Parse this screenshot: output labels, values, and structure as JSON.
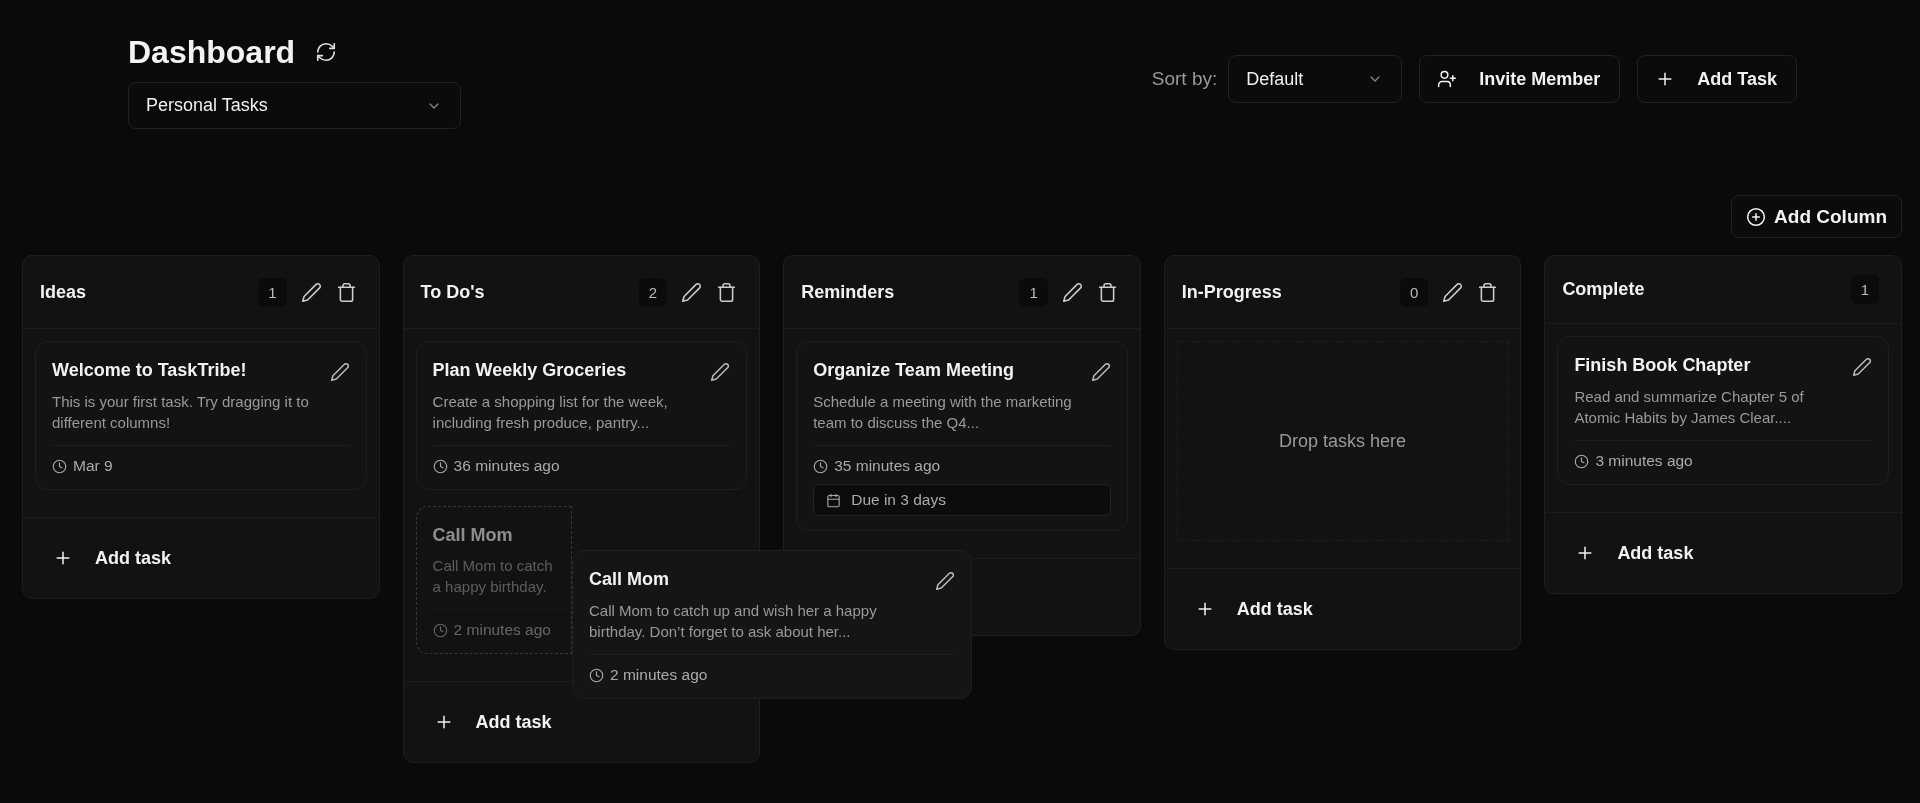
{
  "header": {
    "title": "Dashboard",
    "board_select": {
      "value": "Personal Tasks"
    },
    "sort_label": "Sort by:",
    "sort_select": {
      "value": "Default"
    },
    "buttons": [
      {
        "kind": "invite",
        "label": "Invite Member"
      },
      {
        "kind": "add",
        "label": "Add Task"
      }
    ]
  },
  "add_column": {
    "label": "Add Column"
  },
  "columns": [
    {
      "title": "Ideas",
      "count": "1",
      "editable": true,
      "add_label": "Add task",
      "cards": [
        {
          "title": "Welcome to TaskTribe!",
          "description": "This is your first task. Try dragging it to different columns!",
          "time": "Mar 9",
          "dragging": false
        }
      ]
    },
    {
      "title": "To Do's",
      "count": "2",
      "editable": true,
      "add_label": "Add task",
      "cards": [
        {
          "title": "Plan Weekly Groceries",
          "description": "Create a shopping list for the week, including fresh produce, pantry...",
          "time": "36 minutes ago",
          "dragging": false
        },
        {
          "title": "Call Mom",
          "description": "Call Mom to catch\na happy birthday.",
          "time": "2 minutes ago",
          "dragging": true
        }
      ]
    },
    {
      "title": "Reminders",
      "count": "1",
      "editable": true,
      "cards": [
        {
          "title": "Organize Team Meeting",
          "description": "Schedule a meeting with the marketing team to discuss the Q4...",
          "time": "35 minutes ago",
          "due": "Due in 3 days",
          "dragging": false
        }
      ]
    },
    {
      "title": "In-Progress",
      "count": "0",
      "editable": true,
      "add_label": "Add task",
      "empty_text": "Drop tasks here"
    },
    {
      "title": "Complete",
      "count": "1",
      "editable": false,
      "add_label": "Add task",
      "cards": [
        {
          "title": "Finish Book Chapter",
          "description": "Read and summarize Chapter 5 of Atomic Habits by James Clear....",
          "time": "3 minutes ago",
          "dragging": false
        }
      ]
    }
  ],
  "drag_preview": {
    "title": "Call Mom",
    "description": "Call Mom to catch up and wish her a happy birthday. Don’t forget to ask about her...",
    "time": "2 minutes ago"
  }
}
